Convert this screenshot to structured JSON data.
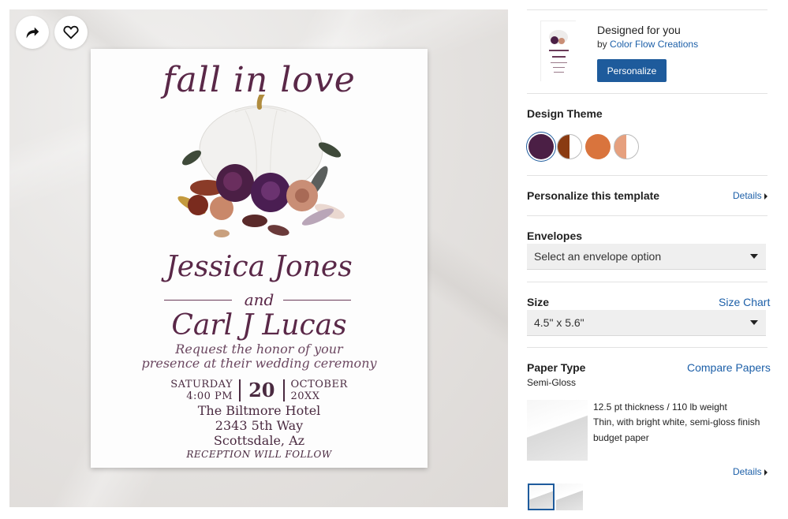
{
  "card": {
    "title": "fall in love",
    "name1": "Jessica Jones",
    "and": "and",
    "name2": "Carl J Lucas",
    "request_line1": "Request the honor of your",
    "request_line2": "presence at their wedding ceremony",
    "day": "SATURDAY",
    "time": "4:00 PM",
    "date_num": "20",
    "month": "OCTOBER",
    "year": "20XX",
    "venue1": "The Biltmore Hotel",
    "venue2": "2343 5th Way",
    "venue3": "Scottsdale, Az",
    "reception": "RECEPTION WILL FOLLOW"
  },
  "designer": {
    "designed_for": "Designed for you",
    "by_prefix": "by",
    "by_name": "Color Flow Creations",
    "personalize_button": "Personalize"
  },
  "design_theme": {
    "heading": "Design Theme",
    "swatches": [
      {
        "name": "plum",
        "color": "#4b1f45"
      },
      {
        "name": "rust-white",
        "color": "#8a3b12"
      },
      {
        "name": "orange",
        "color": "#d9743d"
      },
      {
        "name": "peach-white",
        "color": "#e6a07e"
      }
    ]
  },
  "personalize_template": {
    "heading": "Personalize this template",
    "details": "Details"
  },
  "envelopes": {
    "heading": "Envelopes",
    "selected": "Select an envelope option"
  },
  "size": {
    "heading": "Size",
    "size_chart": "Size Chart",
    "selected": "4.5\" x 5.6\""
  },
  "paper_type": {
    "heading": "Paper Type",
    "compare": "Compare Papers",
    "selected": "Semi-Gloss",
    "desc1": "12.5 pt thickness / 110 lb weight",
    "desc2": "Thin, with bright white, semi-gloss finish",
    "desc3": "budget paper",
    "details": "Details"
  },
  "colors": {
    "accent": "#1c5fa8",
    "button": "#1e5b9c",
    "card_text": "#5a2848"
  }
}
